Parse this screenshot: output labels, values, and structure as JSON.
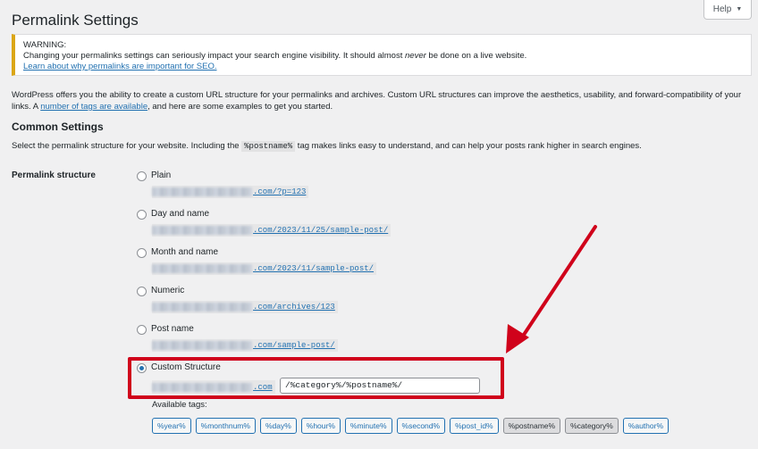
{
  "page": {
    "title": "Permalink Settings",
    "help_label": "Help",
    "help_caret": "▼"
  },
  "notice": {
    "title": "WARNING:",
    "message_pre": "Changing your permalinks settings can seriously impact your search engine visibility. It should almost ",
    "message_em": "never",
    "message_post": " be done on a live website.",
    "link": "Learn about why permalinks are important for SEO."
  },
  "intro": {
    "text_pre": "WordPress offers you the ability to create a custom URL structure for your permalinks and archives. Custom URL structures can improve the aesthetics, usability, and forward-compatibility of your links. A ",
    "link": "number of tags are available",
    "text_post": ", and here are some examples to get you started."
  },
  "common": {
    "title": "Common Settings",
    "desc_pre": "Select the permalink structure for your website. Including the ",
    "desc_code": "%postname%",
    "desc_post": " tag makes links easy to understand, and can help your posts rank higher in search engines."
  },
  "structure": {
    "label": "Permalink structure",
    "options": [
      {
        "label": "Plain",
        "url": ".com/?p=123",
        "checked": false
      },
      {
        "label": "Day and name",
        "url": ".com/2023/11/25/sample-post/",
        "checked": false
      },
      {
        "label": "Month and name",
        "url": ".com/2023/11/sample-post/",
        "checked": false
      },
      {
        "label": "Numeric",
        "url": ".com/archives/123",
        "checked": false
      },
      {
        "label": "Post name",
        "url": ".com/sample-post/",
        "checked": false
      },
      {
        "label": "Custom Structure",
        "url": ".com",
        "checked": true
      }
    ],
    "custom_value": "/%category%/%postname%/",
    "available_label": "Available tags:",
    "tags": [
      "%year%",
      "%monthnum%",
      "%day%",
      "%hour%",
      "%minute%",
      "%second%",
      "%post_id%",
      "%postname%",
      "%category%",
      "%author%"
    ],
    "active_tags": [
      "%postname%",
      "%category%"
    ]
  },
  "colors": {
    "accent": "#2271b1",
    "warning": "#dba617",
    "annotation": "#d0021b"
  }
}
